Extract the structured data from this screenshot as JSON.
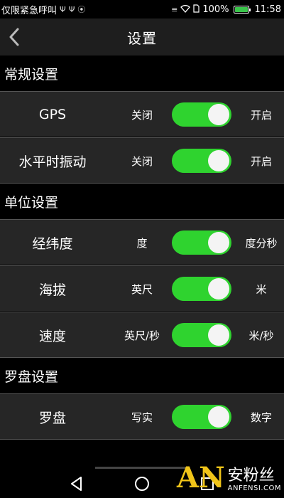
{
  "status_bar": {
    "left_text": "仅限紧急呼叫",
    "left_icons": [
      "usb-icon",
      "usb-icon",
      "vpn-icon"
    ],
    "right_icons": [
      "vibrate-icon",
      "wifi-icon",
      "sim-icon"
    ],
    "battery_percent": "100%",
    "time": "11:58"
  },
  "header": {
    "title": "设置",
    "back_icon": "chevron-left-icon"
  },
  "sections": [
    {
      "title": "常规设置",
      "rows": [
        {
          "label": "GPS",
          "off_label": "关闭",
          "on_label": "开启",
          "enabled": true
        },
        {
          "label": "水平时振动",
          "off_label": "关闭",
          "on_label": "开启",
          "enabled": true
        }
      ]
    },
    {
      "title": "单位设置",
      "rows": [
        {
          "label": "经纬度",
          "off_label": "度",
          "on_label": "度分秒",
          "enabled": true
        },
        {
          "label": "海拔",
          "off_label": "英尺",
          "on_label": "米",
          "enabled": true
        },
        {
          "label": "速度",
          "off_label": "英尺/秒",
          "on_label": "米/秒",
          "enabled": true
        }
      ]
    },
    {
      "title": "罗盘设置",
      "rows": [
        {
          "label": "罗盘",
          "off_label": "写实",
          "on_label": "数字",
          "enabled": true
        }
      ]
    }
  ],
  "nav": {
    "back_icon": "triangle-back-icon",
    "home_icon": "circle-home-icon",
    "recents_icon": "square-recents-icon"
  },
  "watermark": {
    "logo": "AN",
    "name": "安粉丝",
    "domain": "ANFENSI.COM"
  },
  "colors": {
    "toggle_on": "#2fd32f",
    "row_bg": "#262626",
    "title_bg": "#1e1e1e",
    "battery": "#39c44a",
    "watermark_logo": "#f0c419"
  }
}
